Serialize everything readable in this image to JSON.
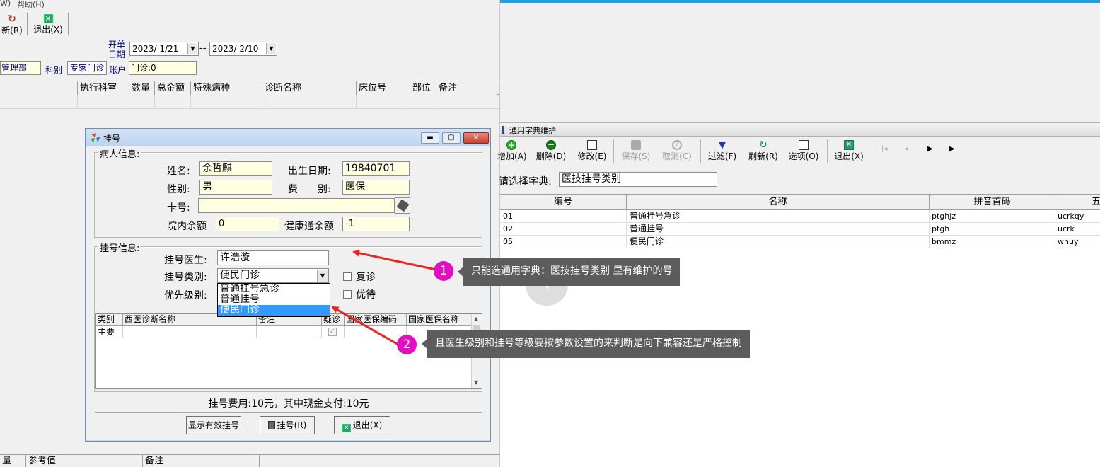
{
  "bg_window": {
    "menu_help": "帮助(H)",
    "menu_partial": "W)",
    "toolbar_refresh": "新(R)",
    "toolbar_exit": "退出(X)",
    "open_date_label": "开单日期",
    "date_from": "2023/ 1/21",
    "date_to": "2023/ 2/10",
    "date_sep": "--",
    "dept_value": "管理部",
    "section_label": "科别",
    "section_value": "专家门诊",
    "account_label": "账户",
    "account_value": "门诊:0",
    "columns": [
      "执行科室",
      "数量",
      "总金额",
      "特殊病种",
      "诊断名称",
      "床位号",
      "部位",
      "备注"
    ],
    "bottom_columns": [
      "量",
      "参考值",
      "备注"
    ]
  },
  "dialog": {
    "title": "挂号",
    "patient_group": "病人信息:",
    "name_label": "姓名:",
    "name_value": "余哲麒",
    "birth_label": "出生日期:",
    "birth_value": "19840701",
    "sex_label": "性别:",
    "sex_value": "男",
    "fee_label": "费　　别:",
    "fee_value": "医保",
    "card_label": "卡号:",
    "card_value": "",
    "balance_label": "院内余额",
    "balance_value": "0",
    "health_label": "健康通余额",
    "health_value": "-1",
    "reg_group": "挂号信息:",
    "doctor_label": "挂号医生:",
    "doctor_value": "许浩漩",
    "type_label": "挂号类别:",
    "type_value": "便民门诊",
    "priority_label": "优先级别:",
    "revisit_label": "复诊",
    "priority_check_label": "优待",
    "dropdown_options": [
      "普通挂号急诊",
      "普通挂号",
      "便民门诊"
    ],
    "diag_columns": [
      "类别",
      "西医诊断名称",
      "备注",
      "疑诊",
      "国家医保编码",
      "国家医保名称"
    ],
    "diag_row_type": "主要",
    "fee_summary": "挂号费用:10元，其中现金支付:10元",
    "show_valid_btn": "显示有效挂号",
    "register_btn": "挂号(R)",
    "exit_btn": "退出(X)"
  },
  "dict_window": {
    "title": "通用字典维护",
    "toolbar": [
      "增加(A)",
      "删除(D)",
      "修改(E)",
      "保存(S)",
      "取消(C)",
      "过滤(F)",
      "刷新(R)",
      "选项(O)",
      "退出(X)"
    ],
    "select_label": "请选择字典:",
    "select_value": "医技挂号类别",
    "columns": [
      "编号",
      "名称",
      "拼音首码",
      "五"
    ],
    "rows": [
      {
        "code": "01",
        "name": "普通挂号急诊",
        "pinyin": "ptghjz",
        "wubi": "ucrkqy"
      },
      {
        "code": "02",
        "name": "普通挂号",
        "pinyin": "ptgh",
        "wubi": "ucrk"
      },
      {
        "code": "05",
        "name": "便民门诊",
        "pinyin": "bmmz",
        "wubi": "wnuy"
      }
    ]
  },
  "annotations": [
    {
      "number": "1",
      "text": "只能选通用字典：医技挂号类别 里有维护的号"
    },
    {
      "number": "2",
      "text": "且医生级别和挂号等级要按参数设置的来判断是向下兼容还是严格控制"
    }
  ],
  "colors": {
    "accent_top": "#1ea0e6",
    "annotation_circle": "#e010c0",
    "arrow": "#e8261e",
    "callout_bg": "#5c5c5c",
    "selection": "#3399ff"
  }
}
